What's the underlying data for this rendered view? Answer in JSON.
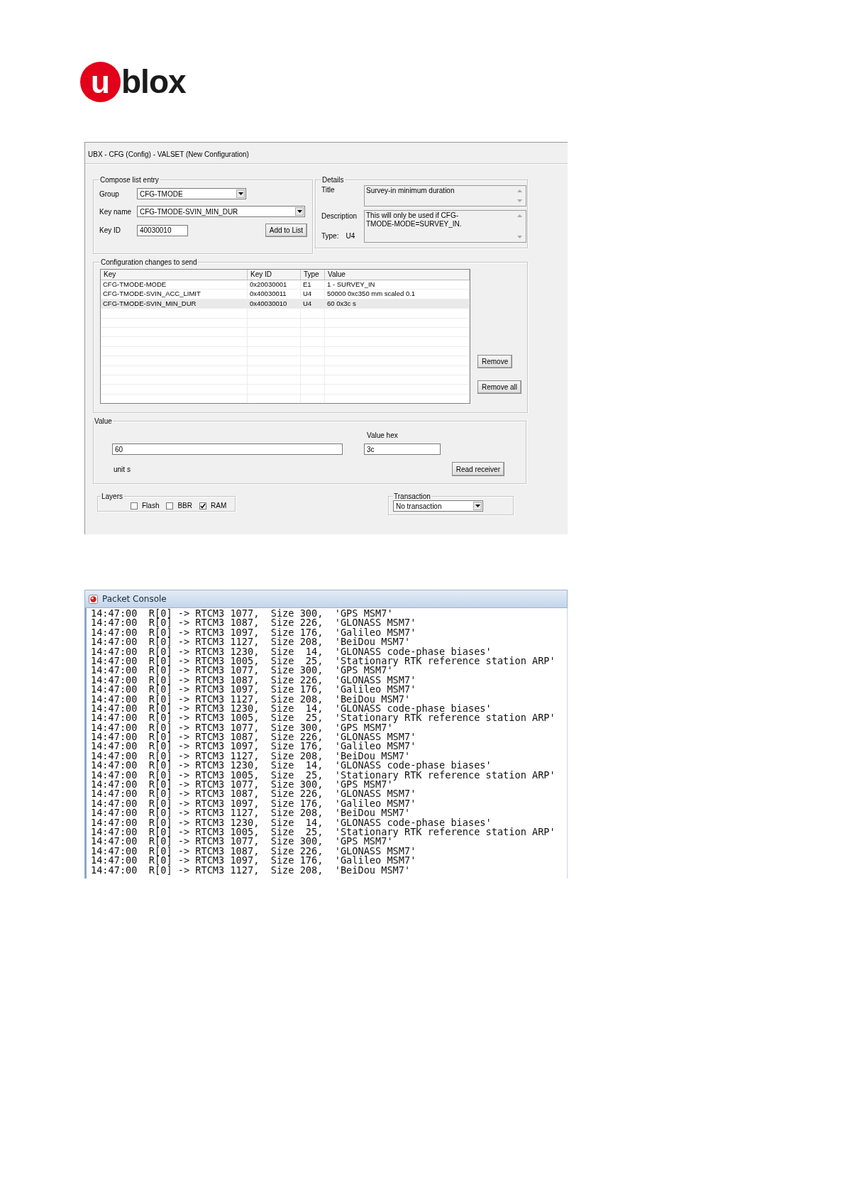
{
  "logo": {
    "badge": "u",
    "wordmark": "blox"
  },
  "config_window": {
    "title": "UBX - CFG (Config) - VALSET (New Configuration)",
    "compose": {
      "legend": "Compose list entry",
      "group": {
        "label": "Group",
        "value": "CFG-TMODE"
      },
      "key_name": {
        "label": "Key name",
        "value": "CFG-TMODE-SVIN_MIN_DUR"
      },
      "key_id": {
        "label": "Key ID",
        "value": "40030010"
      },
      "add_button": "Add to List"
    },
    "details": {
      "legend": "Details",
      "title_label": "Title",
      "title_value": "Survey-in minimum duration",
      "description_label": "Description",
      "description_value": "This will only be used if CFG-TMODE-MODE=SURVEY_IN.",
      "type_label": "Type:",
      "type_value": "U4"
    },
    "changes": {
      "legend": "Configuration changes to send",
      "columns": [
        "Key",
        "Key ID",
        "Type",
        "Value"
      ],
      "rows": [
        {
          "cells": [
            "CFG-TMODE-MODE",
            "0x20030001",
            "E1",
            "1 - SURVEY_IN"
          ],
          "selected": false
        },
        {
          "cells": [
            "CFG-TMODE-SVIN_ACC_LIMIT",
            "0x40030011",
            "U4",
            "50000 0xc350 mm scaled 0.1"
          ],
          "selected": false
        },
        {
          "cells": [
            "CFG-TMODE-SVIN_MIN_DUR",
            "0x40030010",
            "U4",
            "60 0x3c s"
          ],
          "selected": true
        }
      ],
      "buttons": [
        "Remove",
        "Remove all"
      ]
    },
    "value": {
      "legend": "Value",
      "value_field": "60",
      "hex_label": "Value hex",
      "hex_field": "3c",
      "unit": "unit s",
      "read_button": "Read receiver"
    },
    "layers": {
      "legend": "Layers",
      "options": [
        {
          "label": "Flash",
          "checked": false
        },
        {
          "label": "BBR",
          "checked": false
        },
        {
          "label": "RAM",
          "checked": true
        }
      ]
    },
    "transaction": {
      "legend": "Transaction",
      "value": "No transaction"
    }
  },
  "packet_console": {
    "title": "Packet Console",
    "lines": [
      "14:47:00  R[0] -> RTCM3 1077,  Size 300,  'GPS MSM7'",
      "14:47:00  R[0] -> RTCM3 1087,  Size 226,  'GLONASS MSM7'",
      "14:47:00  R[0] -> RTCM3 1097,  Size 176,  'Galileo MSM7'",
      "14:47:00  R[0] -> RTCM3 1127,  Size 208,  'BeiDou MSM7'",
      "14:47:00  R[0] -> RTCM3 1230,  Size  14,  'GLONASS code-phase biases'",
      "14:47:00  R[0] -> RTCM3 1005,  Size  25,  'Stationary RTK reference station ARP'",
      "14:47:00  R[0] -> RTCM3 1077,  Size 300,  'GPS MSM7'",
      "14:47:00  R[0] -> RTCM3 1087,  Size 226,  'GLONASS MSM7'",
      "14:47:00  R[0] -> RTCM3 1097,  Size 176,  'Galileo MSM7'",
      "14:47:00  R[0] -> RTCM3 1127,  Size 208,  'BeiDou MSM7'",
      "14:47:00  R[0] -> RTCM3 1230,  Size  14,  'GLONASS code-phase biases'",
      "14:47:00  R[0] -> RTCM3 1005,  Size  25,  'Stationary RTK reference station ARP'",
      "14:47:00  R[0] -> RTCM3 1077,  Size 300,  'GPS MSM7'",
      "14:47:00  R[0] -> RTCM3 1087,  Size 226,  'GLONASS MSM7'",
      "14:47:00  R[0] -> RTCM3 1097,  Size 176,  'Galileo MSM7'",
      "14:47:00  R[0] -> RTCM3 1127,  Size 208,  'BeiDou MSM7'",
      "14:47:00  R[0] -> RTCM3 1230,  Size  14,  'GLONASS code-phase biases'",
      "14:47:00  R[0] -> RTCM3 1005,  Size  25,  'Stationary RTK reference station ARP'",
      "14:47:00  R[0] -> RTCM3 1077,  Size 300,  'GPS MSM7'",
      "14:47:00  R[0] -> RTCM3 1087,  Size 226,  'GLONASS MSM7'",
      "14:47:00  R[0] -> RTCM3 1097,  Size 176,  'Galileo MSM7'",
      "14:47:00  R[0] -> RTCM3 1127,  Size 208,  'BeiDou MSM7'",
      "14:47:00  R[0] -> RTCM3 1230,  Size  14,  'GLONASS code-phase biases'",
      "14:47:00  R[0] -> RTCM3 1005,  Size  25,  'Stationary RTK reference station ARP'",
      "14:47:00  R[0] -> RTCM3 1077,  Size 300,  'GPS MSM7'",
      "14:47:00  R[0] -> RTCM3 1087,  Size 226,  'GLONASS MSM7'",
      "14:47:00  R[0] -> RTCM3 1097,  Size 176,  'Galileo MSM7'",
      "14:47:00  R[0] -> RTCM3 1127,  Size 208,  'BeiDou MSM7'"
    ]
  }
}
